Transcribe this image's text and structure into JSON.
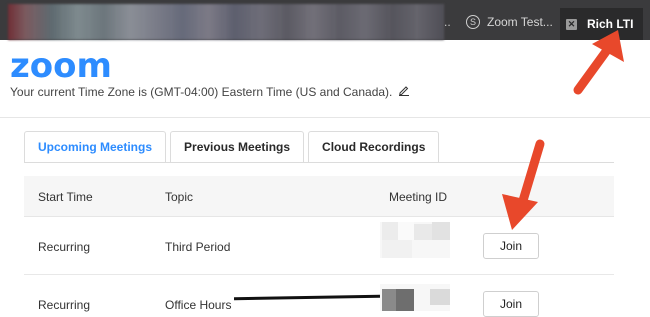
{
  "browser": {
    "tabs": [
      {
        "label": "Zoom Test...",
        "icon": "s-circle-icon"
      },
      {
        "label": "Rich LTI",
        "icon": "close-icon"
      }
    ],
    "overflow_dots": ".."
  },
  "app": {
    "logo": "zoom",
    "timezone_text": "Your current Time Zone is (GMT-04:00) Eastern Time (US and Canada).",
    "accent_color": "#2d8cff"
  },
  "meeting_tabs": [
    {
      "label": "Upcoming Meetings",
      "active": true
    },
    {
      "label": "Previous Meetings",
      "active": false
    },
    {
      "label": "Cloud Recordings",
      "active": false
    }
  ],
  "table": {
    "headers": [
      "Start Time",
      "Topic",
      "Meeting ID"
    ],
    "rows": [
      {
        "start": "Recurring",
        "topic": "Third Period",
        "action": "Join"
      },
      {
        "start": "Recurring",
        "topic": "Office Hours",
        "action": "Join"
      }
    ]
  },
  "annotations": {
    "arrow_color": "#e8482b"
  }
}
